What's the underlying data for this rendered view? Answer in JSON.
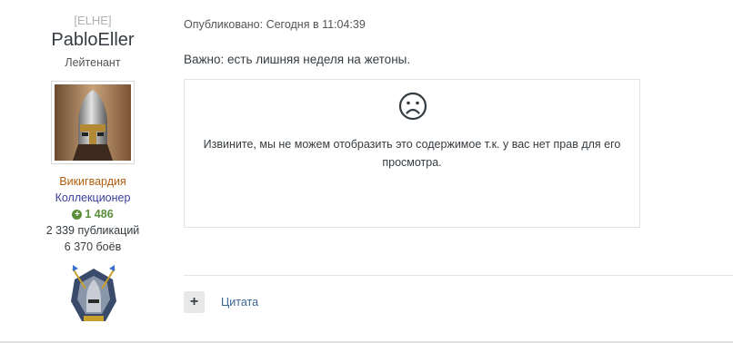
{
  "author": {
    "clan_tag": "[ELHE]",
    "name": "PabloEller",
    "rank": "Лейтенант",
    "groups": [
      "Викигвардия",
      "Коллекционер"
    ],
    "reputation": "1 486",
    "posts_count": "2 339 публикаций",
    "battles_count": "6 370 боёв"
  },
  "post": {
    "published_label": "Опубликовано: Сегодня в 11:04:39",
    "text": "Важно: есть лишняя неделя на жетоны.",
    "restricted_message": "Извините, мы не можем отобразить это содержимое т.к. у вас нет прав для его просмотра."
  },
  "actions": {
    "multiquote_label": "+",
    "quote_label": "Цитата"
  },
  "colors": {
    "group_vikiguard": "#b25e0e",
    "group_collector": "#3a3f9b",
    "reputation": "#5a8f3a",
    "link": "#3d6594"
  },
  "icons": [
    "sad-face-icon",
    "plus-circle-icon",
    "helmet-avatar",
    "rank-badge"
  ]
}
